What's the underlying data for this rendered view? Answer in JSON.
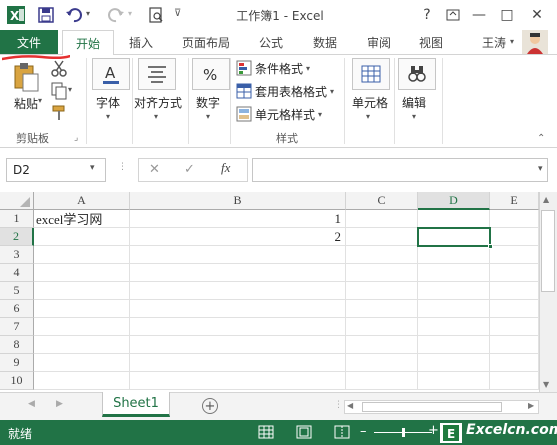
{
  "window": {
    "title": "工作簿1 - Excel",
    "help_icon": "?",
    "minimize_icon": "—",
    "maximize_icon": "□",
    "close_icon": "✕"
  },
  "qat": {
    "app_icon": "excel-icon",
    "save_icon": "save-icon",
    "undo_icon": "undo-icon",
    "redo_icon": "redo-icon",
    "preview_icon": "print-preview-icon",
    "more_icon": "⊽"
  },
  "tabs": {
    "file": "文件",
    "home": "开始",
    "insert": "插入",
    "page_layout": "页面布局",
    "formulas": "公式",
    "data": "数据",
    "review": "审阅",
    "view": "视图",
    "user": "王涛"
  },
  "ribbon": {
    "paste": "粘贴",
    "clipboard": "剪贴板",
    "font": "字体",
    "alignment": "对齐方式",
    "number": "数字",
    "conditional_format": "条件格式",
    "format_as_table": "套用表格格式",
    "cell_styles": "单元格样式",
    "styles": "样式",
    "cells": "单元格",
    "editing": "编辑"
  },
  "formula_bar": {
    "name_box": "D2",
    "fx": "fx",
    "cancel": "✕",
    "enter": "✓",
    "value": ""
  },
  "sheet": {
    "columns": [
      "A",
      "B",
      "C",
      "D",
      "E"
    ],
    "rows": [
      "1",
      "2",
      "3",
      "4",
      "5",
      "6",
      "7",
      "8",
      "9",
      "10"
    ],
    "cells": {
      "A1": "excel学习网",
      "B1": "1",
      "B2": "2"
    },
    "active_cell": "D2",
    "accent": "#217346"
  },
  "sheet_tabs": {
    "active": "Sheet1",
    "add_icon": "+"
  },
  "status": {
    "ready": "就绪",
    "zoom_plus": "+"
  },
  "watermark": "Excelcn.com"
}
